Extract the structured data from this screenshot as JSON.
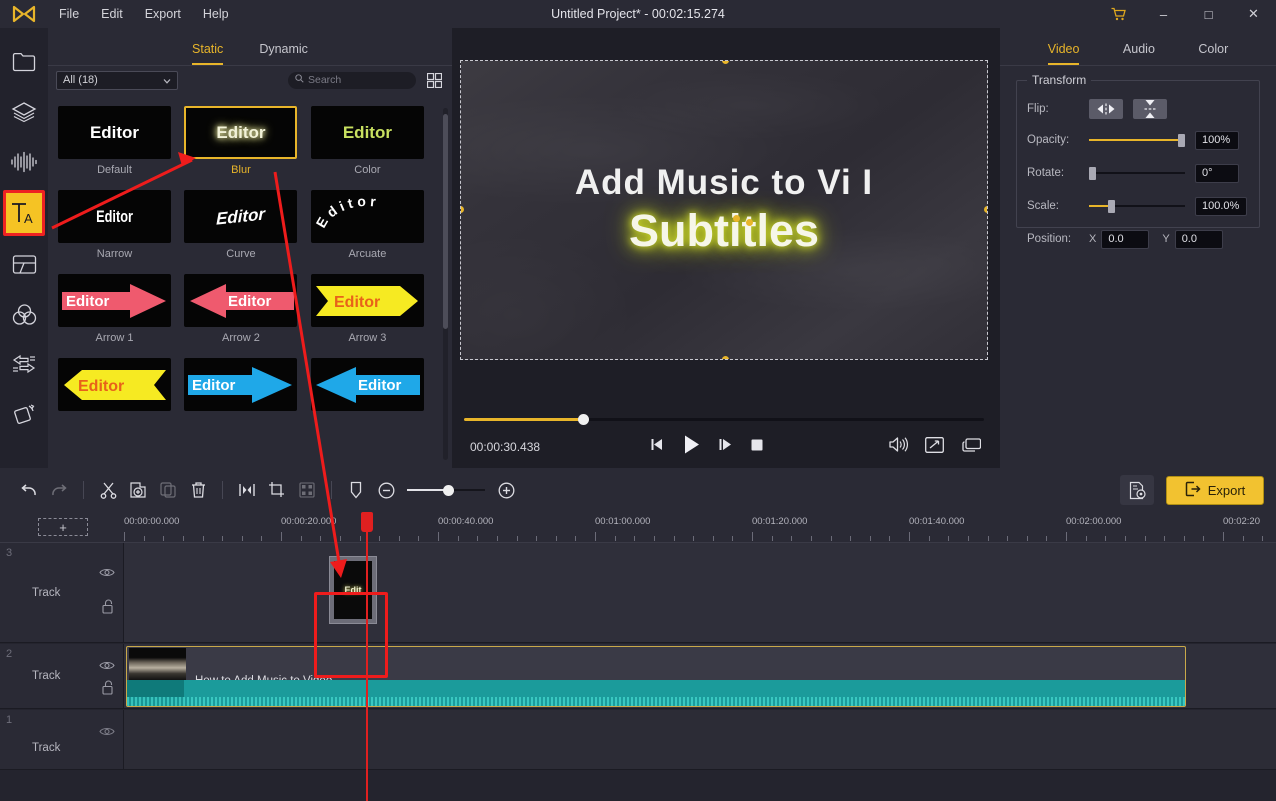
{
  "titlebar": {
    "logo_icon": "app-logo-icon",
    "project_title": "Untitled Project* - 00:02:15.274",
    "menus": [
      "File",
      "Edit",
      "Export",
      "Help"
    ],
    "cart_icon": "cart-icon",
    "minimize": "–",
    "maximize": "□",
    "close": "✕"
  },
  "rail": {
    "items": [
      {
        "icon": "folder-icon",
        "name": "media"
      },
      {
        "icon": "layers-icon",
        "name": "stickers"
      },
      {
        "icon": "audio-wave-icon",
        "name": "audio"
      },
      {
        "icon": "text-ta-icon",
        "name": "text",
        "active": true
      },
      {
        "icon": "split-screen-icon",
        "name": "split-screen"
      },
      {
        "icon": "color-circles-icon",
        "name": "filters"
      },
      {
        "icon": "transition-arrows-icon",
        "name": "transitions"
      },
      {
        "icon": "motion-cube-icon",
        "name": "effects"
      }
    ]
  },
  "library": {
    "tabs": [
      {
        "label": "Static",
        "active": true
      },
      {
        "label": "Dynamic",
        "active": false
      }
    ],
    "filter_value": "All (18)",
    "search_placeholder": "Search",
    "grid_icon": "grid-view-icon",
    "templates": [
      {
        "label": "Default",
        "sample": "Editor",
        "style": "plain",
        "selected": false
      },
      {
        "label": "Blur",
        "sample": "Editor",
        "style": "blur",
        "selected": true
      },
      {
        "label": "Color",
        "sample": "Editor",
        "style": "color",
        "selected": false
      },
      {
        "label": "Narrow",
        "sample": "Editor",
        "style": "narrow",
        "selected": false
      },
      {
        "label": "Curve",
        "sample": "Editor",
        "style": "curve",
        "selected": false
      },
      {
        "label": "Arcuate",
        "sample": "Editor",
        "style": "arcuate",
        "selected": false
      },
      {
        "label": "Arrow 1",
        "sample": "Editor",
        "style": "arrow-right-pink",
        "selected": false
      },
      {
        "label": "Arrow 2",
        "sample": "Editor",
        "style": "arrow-left-pink",
        "selected": false
      },
      {
        "label": "Arrow 3",
        "sample": "Editor",
        "style": "arrow-right-yellow",
        "selected": false
      },
      {
        "label": "",
        "sample": "Editor",
        "style": "arrow-left-yellow",
        "selected": false
      },
      {
        "label": "",
        "sample": "Editor",
        "style": "arrow-right-blue",
        "selected": false
      },
      {
        "label": "",
        "sample": "Editor",
        "style": "arrow-left-blue",
        "selected": false
      }
    ]
  },
  "preview": {
    "overlay_line1": "Add Music to Vi I",
    "overlay_line2": "Subtitles",
    "current_time": "00:00:30.438",
    "transport": [
      {
        "name": "prev-frame-button",
        "icon": "prev-frame-icon"
      },
      {
        "name": "play-button",
        "icon": "play-icon"
      },
      {
        "name": "next-frame-button",
        "icon": "next-frame-icon"
      },
      {
        "name": "stop-button",
        "icon": "stop-icon"
      }
    ],
    "right_controls": [
      {
        "name": "volume-button",
        "icon": "volume-icon"
      },
      {
        "name": "fullscreen-button",
        "icon": "fullscreen-icon"
      },
      {
        "name": "snapshot-button",
        "icon": "pip-icon"
      }
    ]
  },
  "properties": {
    "tabs": [
      {
        "label": "Video",
        "active": true
      },
      {
        "label": "Audio",
        "active": false
      },
      {
        "label": "Color",
        "active": false
      }
    ],
    "group_title": "Transform",
    "rows": {
      "flip_label": "Flip:",
      "flip_h_icon": "flip-horizontal-icon",
      "flip_v_icon": "flip-vertical-icon",
      "opacity_label": "Opacity:",
      "opacity_value": "100%",
      "rotate_label": "Rotate:",
      "rotate_value": "0°",
      "scale_label": "Scale:",
      "scale_value": "100.0%",
      "position_label": "Position:",
      "pos_x_label": "X",
      "pos_x_value": "0.0",
      "pos_y_label": "Y",
      "pos_y_value": "0.0"
    }
  },
  "toolbar": {
    "buttons": [
      {
        "name": "undo-button",
        "icon": "undo-icon",
        "disabled": false
      },
      {
        "name": "redo-button",
        "icon": "redo-icon",
        "disabled": true
      },
      {
        "name": "cut-button",
        "icon": "scissors-icon",
        "disabled": false
      },
      {
        "name": "add-button",
        "icon": "add-clip-icon",
        "disabled": false
      },
      {
        "name": "copy-button",
        "icon": "copy-icon",
        "disabled": true
      },
      {
        "name": "delete-button",
        "icon": "trash-icon",
        "disabled": false
      },
      {
        "name": "split-button",
        "icon": "split-icon",
        "disabled": false
      },
      {
        "name": "crop-button",
        "icon": "crop-icon",
        "disabled": false
      },
      {
        "name": "mosaic-button",
        "icon": "mosaic-icon",
        "disabled": true
      },
      {
        "name": "marker-button",
        "icon": "marker-icon",
        "disabled": false
      }
    ],
    "zoom_out_icon": "zoom-out-icon",
    "zoom_in_icon": "zoom-in-icon",
    "settings_icon": "project-settings-icon",
    "export_label": "Export",
    "export_icon": "export-arrow-icon"
  },
  "timeline": {
    "add_track_label": "+",
    "ruler_labels": [
      "00:00:00.000",
      "00:00:20.000",
      "00:00:40.000",
      "00:01:00.000",
      "00:01:20.000",
      "00:01:40.000",
      "00:02:00.000",
      "00:02:20"
    ],
    "tracks": [
      {
        "num": "3",
        "name": "Track",
        "eye_icon": "eye-icon",
        "lock_icon": "unlock-icon"
      },
      {
        "num": "2",
        "name": "Track",
        "eye_icon": "eye-icon",
        "lock_icon": "unlock-icon"
      },
      {
        "num": "1",
        "name": "Track",
        "eye_icon": "eye-icon",
        "lock_icon": "unlock-icon"
      }
    ],
    "text_clip_label": "Edit",
    "video_clip_title": "How to Add Music to Video"
  },
  "colors": {
    "accent": "#e8b52a",
    "export_bg": "#f2c230",
    "annotation_red": "#ee1c1c",
    "playhead_red": "#e02020",
    "audio_teal": "#1b9b9b",
    "panel_bg": "#2a2a35",
    "app_bg": "#1e1e26"
  }
}
